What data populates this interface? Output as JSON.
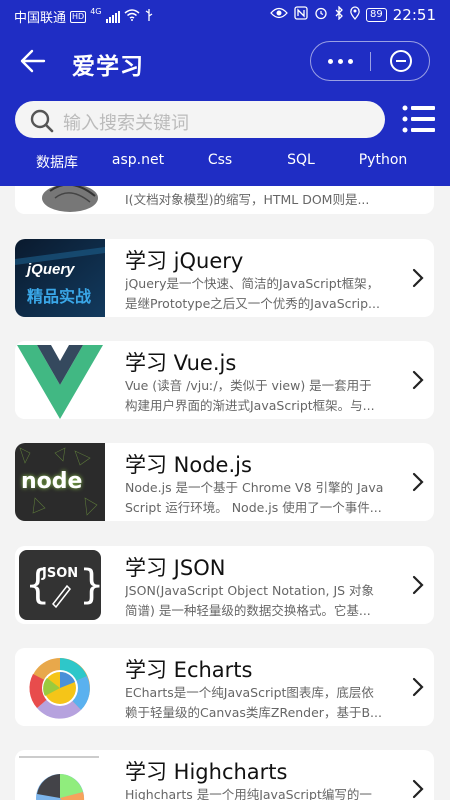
{
  "status_bar": {
    "carrier": "中国联通",
    "hd": "HD",
    "network": "4G",
    "battery": "89",
    "time": "22:51"
  },
  "header": {
    "title": "爱学习",
    "background": "#1f2dc4"
  },
  "search": {
    "placeholder": "输入搜索关键词"
  },
  "tabs": [
    "数据库",
    "asp.net",
    "Css",
    "SQL",
    "Python"
  ],
  "cards": [
    {
      "title": "",
      "desc_line1": "",
      "desc_line2": "I(文档对象模型)的缩写，HTML DOM则是..."
    },
    {
      "title": "学习 jQuery",
      "desc_line1": "jQuery是一个快速、简洁的JavaScript框架，",
      "desc_line2": "是继Prototype之后又一个优秀的JavaScrip...",
      "thumb_text": "jQuery",
      "thumb_sub": "精品实战"
    },
    {
      "title": "学习 Vue.js",
      "desc_line1": "Vue (读音 /vjuː/，类似于 view) 是一套用于",
      "desc_line2": "构建用户界面的渐进式JavaScript框架。与..."
    },
    {
      "title": "学习 Node.js",
      "desc_line1": "Node.js 是一个基于 Chrome V8 引擎的 Java",
      "desc_line2": "Script 运行环境。 Node.js 使用了一个事件...",
      "thumb_text": "node"
    },
    {
      "title": "学习 JSON",
      "desc_line1": "JSON(JavaScript Object Notation, JS 对象",
      "desc_line2": "简谱) 是一种轻量级的数据交换格式。它基...",
      "thumb_text": "JSON"
    },
    {
      "title": "学习 Echarts",
      "desc_line1": "ECharts是一个纯JavaScript图表库，底层依",
      "desc_line2": "赖于轻量级的Canvas类库ZRender，基于B..."
    },
    {
      "title": "学习 Highcharts",
      "desc_line1": "Highcharts 是一个用纯JavaScript编写的一",
      "desc_line2": ""
    }
  ]
}
